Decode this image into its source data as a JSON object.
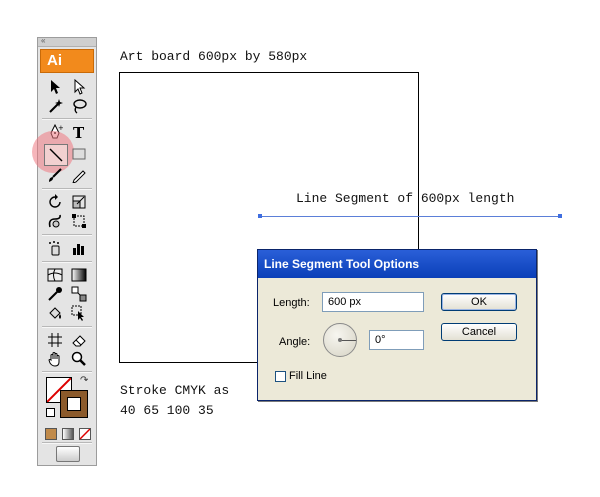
{
  "toolbox": {
    "app_logo": "Ai",
    "grip": "«"
  },
  "artboard_caption": "Art board 600px by 580px",
  "segment_caption": "Line Segment of 600px length",
  "stroke_caption": {
    "line1": "Stroke CMYK as",
    "line2": "40 65 100 35"
  },
  "dialog": {
    "title": "Line Segment Tool Options",
    "length_label": "Length:",
    "length_value": "600 px",
    "angle_label": "Angle:",
    "angle_value": "0°",
    "fill_line_label": "Fill Line",
    "fill_line_checked": false,
    "ok_label": "OK",
    "cancel_label": "Cancel"
  },
  "colors": {
    "stroke_swatch": "#8b5a2b",
    "highlight": "#ef7882",
    "segment": "#5b7fd8"
  }
}
